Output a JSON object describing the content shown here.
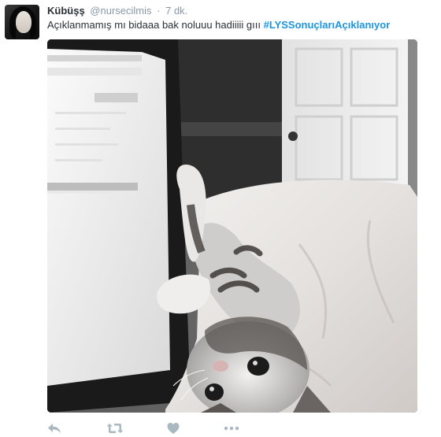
{
  "tweet": {
    "author_name": "Kübüşş",
    "author_handle": "@nursecilmis",
    "separator": "·",
    "timestamp": "7 dk.",
    "text": "Açıklanmamış mı bidaaa bak noluuu hadiiiii gııı",
    "hashtag": "#LYSSonuçlarıAçıklanıyor"
  },
  "media": {
    "photo_subject": "kitten lying on bed next to laptop screen"
  },
  "actions": {
    "icons": [
      "reply-icon",
      "retweet-icon",
      "like-icon",
      "more-icon"
    ]
  },
  "colors": {
    "link": "#1b95e0",
    "meta": "#8899a6",
    "text": "#292f33",
    "action_icon": "#aab8c2"
  }
}
